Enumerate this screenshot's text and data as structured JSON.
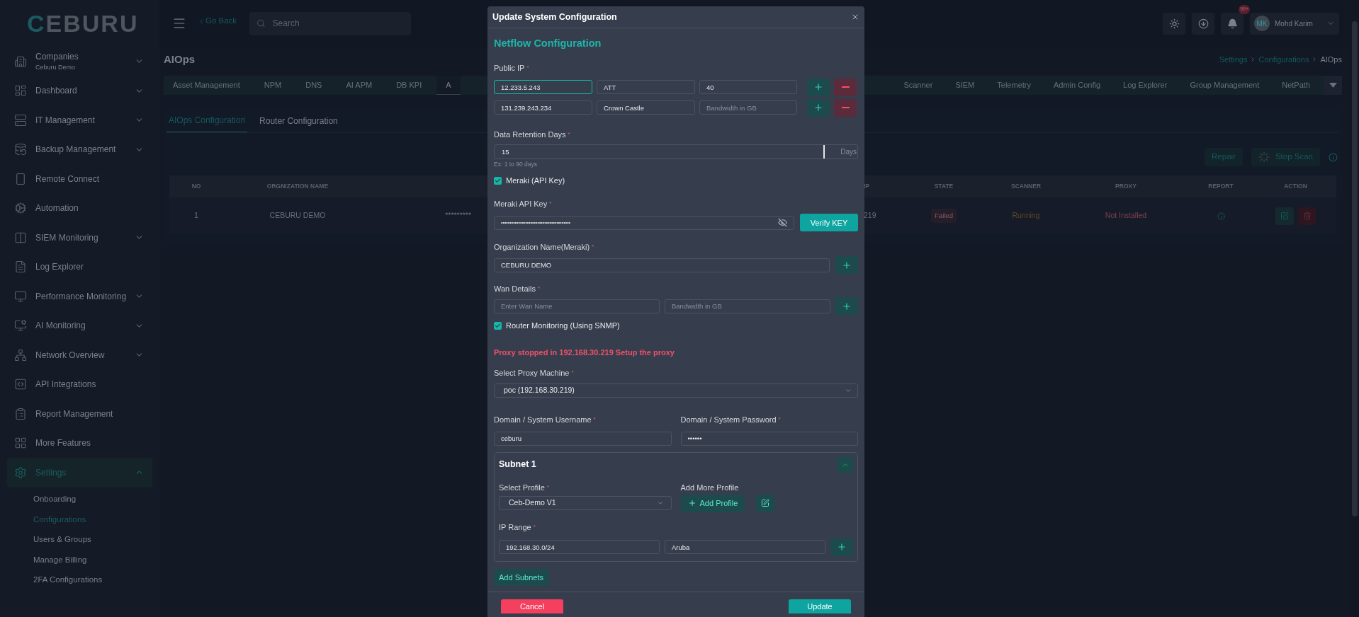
{
  "sidebar": {
    "logo": "CEBURU",
    "items": [
      {
        "label": "Companies",
        "subtitle": "Ceburu Demo",
        "expanded": false,
        "selected": false
      },
      {
        "label": "Dashboard",
        "expanded": false,
        "selected": false
      },
      {
        "label": "IT Management",
        "expanded": false,
        "selected": false
      },
      {
        "label": "Backup Management",
        "expanded": false,
        "selected": false
      },
      {
        "label": "Remote Connect",
        "selected": false
      },
      {
        "label": "Automation",
        "selected": false
      },
      {
        "label": "SIEM Monitoring",
        "expanded": false,
        "selected": false
      },
      {
        "label": "Log Explorer",
        "selected": false
      },
      {
        "label": "Performance Monitoring",
        "expanded": false,
        "selected": false
      },
      {
        "label": "AI Monitoring",
        "expanded": false,
        "selected": false
      },
      {
        "label": "Network Overview",
        "expanded": false,
        "selected": false
      },
      {
        "label": "API Integrations",
        "selected": false
      },
      {
        "label": "Report Management",
        "selected": false
      },
      {
        "label": "More Features",
        "selected": false
      },
      {
        "label": "Settings",
        "expanded": true,
        "selected": true,
        "children": [
          {
            "label": "Onboarding",
            "selected": false
          },
          {
            "label": "Configurations",
            "selected": true
          },
          {
            "label": "Users & Groups",
            "selected": false
          },
          {
            "label": "Manage Billing",
            "selected": false
          },
          {
            "label": "2FA Configurations",
            "selected": false
          }
        ]
      }
    ]
  },
  "topbar": {
    "go_back": "Go Back",
    "search": {
      "placeholder": "Search"
    },
    "notification_badge": "99+",
    "user": {
      "initials": "MK",
      "name": "Mohd Karim"
    }
  },
  "page": {
    "title": "AIOps",
    "breadcrumb": [
      "Settings",
      "Configurations",
      "AIOps"
    ],
    "tabs_left": [
      {
        "label": "Asset Management",
        "selected": false
      },
      {
        "label": "NPM",
        "selected": false
      },
      {
        "label": "DNS",
        "selected": false
      },
      {
        "label": "AI APM",
        "selected": false
      },
      {
        "label": "DB KPI",
        "selected": false
      },
      {
        "label": "A",
        "selected": true
      }
    ],
    "tabs_right": [
      {
        "label": "Scanner",
        "selected": false
      },
      {
        "label": "SIEM",
        "selected": false
      },
      {
        "label": "Telemetry",
        "selected": false
      },
      {
        "label": "Admin Config",
        "selected": false
      },
      {
        "label": "Log Explorer",
        "selected": false
      },
      {
        "label": "Group Management",
        "selected": false
      },
      {
        "label": "NetPath",
        "selected": false
      }
    ],
    "subtabs": [
      {
        "label": "AIOps Configuration",
        "selected": true
      },
      {
        "label": "Router Configuration",
        "selected": false
      }
    ],
    "actions": {
      "repair": "Repair",
      "stop_scan": "Stop Scan"
    },
    "table": {
      "columns_left": [
        "NO",
        "ORGNIZATION NAME"
      ],
      "columns_right": [
        "IP",
        "STATE",
        "SCANNER",
        "PROXY",
        "REPORT",
        "ACTION"
      ],
      "rows": [
        {
          "no": "1",
          "organization": "CEBURU DEMO",
          "column_3": "*********",
          "ip": "219",
          "state": "Failed",
          "scanner": "Running",
          "proxy": "Not Installed"
        }
      ]
    }
  },
  "modal": {
    "title": "Update System Configuration",
    "section_title": "Netflow Configuration",
    "public_ip": {
      "label": "Public IP",
      "mark": "*",
      "rows": [
        {
          "ip": {
            "value": "12.233.5.243",
            "focused": true
          },
          "name": {
            "value": "ATT"
          },
          "bandwidth": {
            "value": "40"
          }
        },
        {
          "ip": {
            "value": "131.239.243.234",
            "focused": false
          },
          "name": {
            "value": "Crown Castle"
          },
          "bandwidth": {
            "placeholder": "Bandwidth in GB"
          }
        }
      ]
    },
    "retention": {
      "label": "Data Retention Days",
      "mark": "*",
      "value": "15",
      "unit": "Days",
      "hint": "Ex: 1 to 90 days"
    },
    "meraki": {
      "label": "Meraki (API Key)",
      "checked": true
    },
    "api_key": {
      "label": "Meraki API Key",
      "mark": "*",
      "value": "••••••••••••••••••••••••••••••••••••••••",
      "verify": "Verify KEY"
    },
    "org_name": {
      "label": "Organization Name(Meraki)",
      "mark": "*",
      "value": "CEBURU DEMO"
    },
    "wan": {
      "label": "Wan Details",
      "mark": "*",
      "name": {
        "placeholder": "Enter Wan Name"
      },
      "bandwidth": {
        "placeholder": "Bandwidth in GB"
      }
    },
    "router_monitoring": {
      "label": "Router Monitoring (Using SNMP)",
      "checked": true
    },
    "warning": "Proxy stopped in 192.168.30.219 Setup the proxy",
    "proxy": {
      "label": "Select Proxy Machine",
      "mark": "*",
      "value": "poc (192.168.30.219)"
    },
    "username": {
      "label": "Domain / System Username",
      "mark": "*",
      "value": "ceburu"
    },
    "password": {
      "label": "Domain / System Password",
      "mark": "*",
      "value": "••••••"
    },
    "subnet": {
      "title": "Subnet 1",
      "expanded": true,
      "profile": {
        "label": "Select Profile",
        "mark": "*",
        "value": "Ceb-Demo V1"
      },
      "add_more": {
        "label": "Add More Profile",
        "button": "Add Profile"
      },
      "ip_range": {
        "label": "IP Range",
        "mark": "*",
        "from": {
          "value": "192.168.30.0/24"
        },
        "name": {
          "value": "Aruba"
        }
      }
    },
    "add_subnets": "Add Subnets",
    "cancel": "Cancel",
    "update": "Update"
  }
}
